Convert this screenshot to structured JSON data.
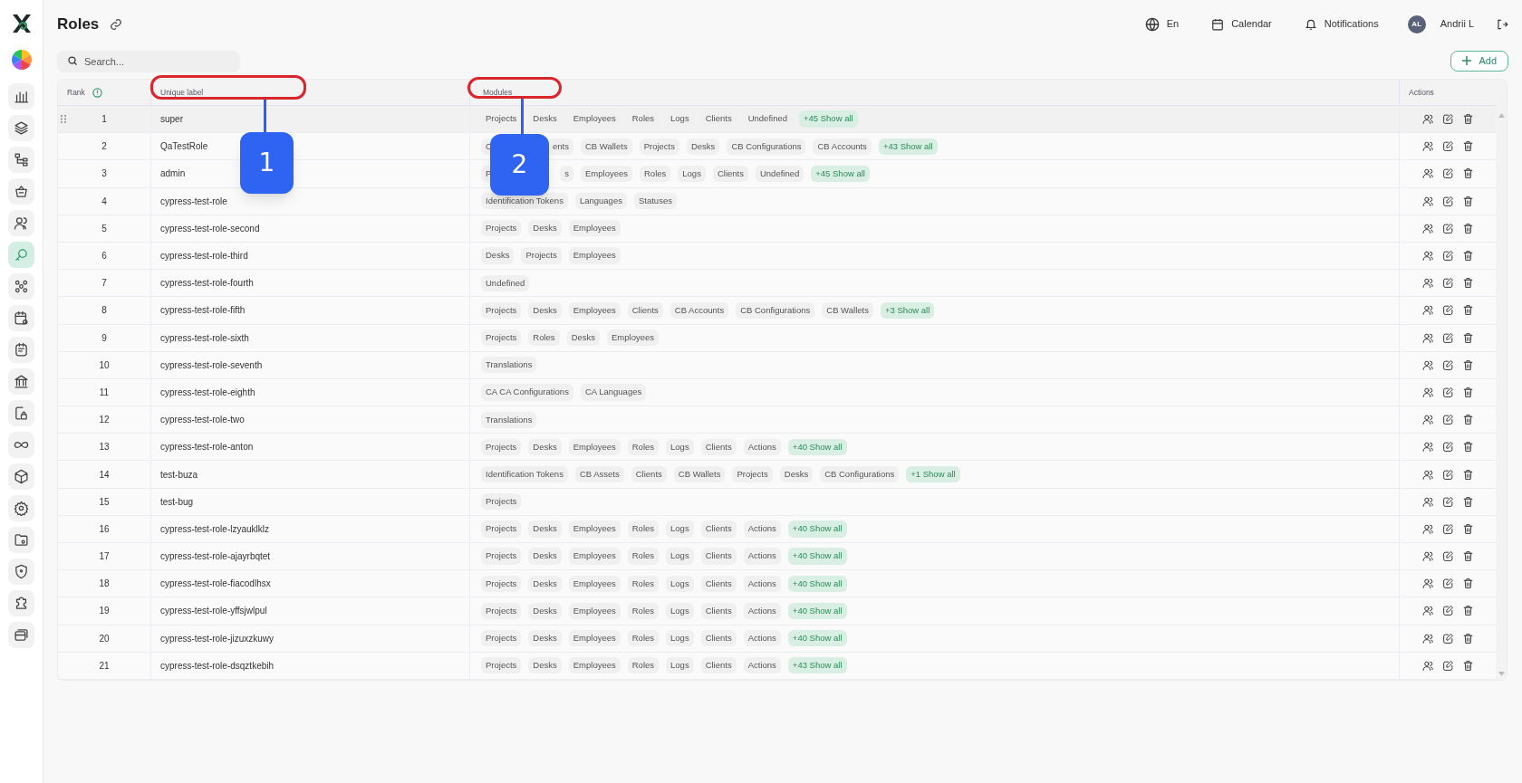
{
  "sidebar": {
    "items": [
      {
        "selected": false
      },
      {
        "selected": false
      },
      {
        "selected": false
      },
      {
        "selected": false
      },
      {
        "selected": false
      },
      {
        "selected": true
      },
      {
        "selected": false
      },
      {
        "selected": false
      },
      {
        "selected": false
      },
      {
        "selected": false
      },
      {
        "selected": false
      },
      {
        "selected": false
      },
      {
        "selected": false
      },
      {
        "selected": false
      },
      {
        "selected": false
      },
      {
        "selected": false
      },
      {
        "selected": false
      },
      {
        "selected": false
      }
    ]
  },
  "header": {
    "title": "Roles",
    "language": "En",
    "calendar": "Calendar",
    "notifications": "Notifications",
    "avatar": "AL",
    "user": "Andrii L"
  },
  "search": {
    "placeholder": "Search..."
  },
  "add_button": "Add",
  "table": {
    "columns": [
      "Rank",
      "Unique label",
      "Modules",
      "Actions"
    ],
    "rows": [
      {
        "rank": "1",
        "label": "super",
        "hovered": true,
        "modules": [
          {
            "kind": "module",
            "text": "Projects"
          },
          {
            "kind": "module",
            "text": "Desks"
          },
          {
            "kind": "module",
            "text": "Employees"
          },
          {
            "kind": "module",
            "text": "Roles"
          },
          {
            "kind": "module",
            "text": "Logs"
          },
          {
            "kind": "module",
            "text": "Clients"
          },
          {
            "kind": "module",
            "text": "Undefined"
          },
          {
            "kind": "more",
            "text": "+45 Show all"
          }
        ]
      },
      {
        "rank": "2",
        "label": "QaTestRole",
        "hovered": false,
        "modules": [
          {
            "kind": "split",
            "start": "C",
            "end": "ents"
          },
          {
            "kind": "module",
            "text": "CB Wallets"
          },
          {
            "kind": "module",
            "text": "Projects"
          },
          {
            "kind": "module",
            "text": "Desks"
          },
          {
            "kind": "module",
            "text": "CB Configurations"
          },
          {
            "kind": "module",
            "text": "CB Accounts"
          },
          {
            "kind": "more",
            "text": "+43 Show all"
          }
        ]
      },
      {
        "rank": "3",
        "label": "admin",
        "hovered": false,
        "modules": [
          {
            "kind": "split",
            "start": "P",
            "end": "s"
          },
          {
            "kind": "module",
            "text": "Employees"
          },
          {
            "kind": "module",
            "text": "Roles"
          },
          {
            "kind": "module",
            "text": "Logs"
          },
          {
            "kind": "module",
            "text": "Clients"
          },
          {
            "kind": "module",
            "text": "Undefined"
          },
          {
            "kind": "more",
            "text": "+45 Show all"
          }
        ]
      },
      {
        "rank": "4",
        "label": "cypress-test-role",
        "hovered": false,
        "modules": [
          {
            "kind": "module",
            "text": "Identification Tokens"
          },
          {
            "kind": "module",
            "text": "Languages"
          },
          {
            "kind": "module",
            "text": "Statuses"
          }
        ]
      },
      {
        "rank": "5",
        "label": "cypress-test-role-second",
        "hovered": false,
        "modules": [
          {
            "kind": "module",
            "text": "Projects"
          },
          {
            "kind": "module",
            "text": "Desks"
          },
          {
            "kind": "module",
            "text": "Employees"
          }
        ]
      },
      {
        "rank": "6",
        "label": "cypress-test-role-third",
        "hovered": false,
        "modules": [
          {
            "kind": "module",
            "text": "Desks"
          },
          {
            "kind": "module",
            "text": "Projects"
          },
          {
            "kind": "module",
            "text": "Employees"
          }
        ]
      },
      {
        "rank": "7",
        "label": "cypress-test-role-fourth",
        "hovered": false,
        "modules": [
          {
            "kind": "module",
            "text": "Undefined"
          }
        ]
      },
      {
        "rank": "8",
        "label": "cypress-test-role-fifth",
        "hovered": false,
        "modules": [
          {
            "kind": "module",
            "text": "Projects"
          },
          {
            "kind": "module",
            "text": "Desks"
          },
          {
            "kind": "module",
            "text": "Employees"
          },
          {
            "kind": "module",
            "text": "Clients"
          },
          {
            "kind": "module",
            "text": "CB Accounts"
          },
          {
            "kind": "module",
            "text": "CB Configurations"
          },
          {
            "kind": "module",
            "text": "CB Wallets"
          },
          {
            "kind": "more",
            "text": "+3 Show all"
          }
        ]
      },
      {
        "rank": "9",
        "label": "cypress-test-role-sixth",
        "hovered": false,
        "modules": [
          {
            "kind": "module",
            "text": "Projects"
          },
          {
            "kind": "module",
            "text": "Roles"
          },
          {
            "kind": "module",
            "text": "Desks"
          },
          {
            "kind": "module",
            "text": "Employees"
          }
        ]
      },
      {
        "rank": "10",
        "label": "cypress-test-role-seventh",
        "hovered": false,
        "modules": [
          {
            "kind": "module",
            "text": "Translations"
          }
        ]
      },
      {
        "rank": "11",
        "label": "cypress-test-role-eighth",
        "hovered": false,
        "modules": [
          {
            "kind": "module",
            "text": "CA CA Configurations"
          },
          {
            "kind": "module",
            "text": "CA Languages"
          }
        ]
      },
      {
        "rank": "12",
        "label": "cypress-test-role-two",
        "hovered": false,
        "modules": [
          {
            "kind": "module",
            "text": "Translations"
          }
        ]
      },
      {
        "rank": "13",
        "label": "cypress-test-role-anton",
        "hovered": false,
        "modules": [
          {
            "kind": "module",
            "text": "Projects"
          },
          {
            "kind": "module",
            "text": "Desks"
          },
          {
            "kind": "module",
            "text": "Employees"
          },
          {
            "kind": "module",
            "text": "Roles"
          },
          {
            "kind": "module",
            "text": "Logs"
          },
          {
            "kind": "module",
            "text": "Clients"
          },
          {
            "kind": "module",
            "text": "Actions"
          },
          {
            "kind": "more",
            "text": "+40 Show all"
          }
        ]
      },
      {
        "rank": "14",
        "label": "test-buza",
        "hovered": false,
        "modules": [
          {
            "kind": "module",
            "text": "Identification Tokens"
          },
          {
            "kind": "module",
            "text": "CB Assets"
          },
          {
            "kind": "module",
            "text": "Clients"
          },
          {
            "kind": "module",
            "text": "CB Wallets"
          },
          {
            "kind": "module",
            "text": "Projects"
          },
          {
            "kind": "module",
            "text": "Desks"
          },
          {
            "kind": "module",
            "text": "CB Configurations"
          },
          {
            "kind": "more",
            "text": "+1 Show all"
          }
        ]
      },
      {
        "rank": "15",
        "label": "test-bug",
        "hovered": false,
        "modules": [
          {
            "kind": "module",
            "text": "Projects"
          }
        ]
      },
      {
        "rank": "16",
        "label": "cypress-test-role-lzyauklklz",
        "hovered": false,
        "modules": [
          {
            "kind": "module",
            "text": "Projects"
          },
          {
            "kind": "module",
            "text": "Desks"
          },
          {
            "kind": "module",
            "text": "Employees"
          },
          {
            "kind": "module",
            "text": "Roles"
          },
          {
            "kind": "module",
            "text": "Logs"
          },
          {
            "kind": "module",
            "text": "Clients"
          },
          {
            "kind": "module",
            "text": "Actions"
          },
          {
            "kind": "more",
            "text": "+40 Show all"
          }
        ]
      },
      {
        "rank": "17",
        "label": "cypress-test-role-ajayrbqtet",
        "hovered": false,
        "modules": [
          {
            "kind": "module",
            "text": "Projects"
          },
          {
            "kind": "module",
            "text": "Desks"
          },
          {
            "kind": "module",
            "text": "Employees"
          },
          {
            "kind": "module",
            "text": "Roles"
          },
          {
            "kind": "module",
            "text": "Logs"
          },
          {
            "kind": "module",
            "text": "Clients"
          },
          {
            "kind": "module",
            "text": "Actions"
          },
          {
            "kind": "more",
            "text": "+40 Show all"
          }
        ]
      },
      {
        "rank": "18",
        "label": "cypress-test-role-fiacodlhsx",
        "hovered": false,
        "modules": [
          {
            "kind": "module",
            "text": "Projects"
          },
          {
            "kind": "module",
            "text": "Desks"
          },
          {
            "kind": "module",
            "text": "Employees"
          },
          {
            "kind": "module",
            "text": "Roles"
          },
          {
            "kind": "module",
            "text": "Logs"
          },
          {
            "kind": "module",
            "text": "Clients"
          },
          {
            "kind": "module",
            "text": "Actions"
          },
          {
            "kind": "more",
            "text": "+40 Show all"
          }
        ]
      },
      {
        "rank": "19",
        "label": "cypress-test-role-yffsjwlpul",
        "hovered": false,
        "modules": [
          {
            "kind": "module",
            "text": "Projects"
          },
          {
            "kind": "module",
            "text": "Desks"
          },
          {
            "kind": "module",
            "text": "Employees"
          },
          {
            "kind": "module",
            "text": "Roles"
          },
          {
            "kind": "module",
            "text": "Logs"
          },
          {
            "kind": "module",
            "text": "Clients"
          },
          {
            "kind": "module",
            "text": "Actions"
          },
          {
            "kind": "more",
            "text": "+40 Show all"
          }
        ]
      },
      {
        "rank": "20",
        "label": "cypress-test-role-jizuxzkuwy",
        "hovered": false,
        "modules": [
          {
            "kind": "module",
            "text": "Projects"
          },
          {
            "kind": "module",
            "text": "Desks"
          },
          {
            "kind": "module",
            "text": "Employees"
          },
          {
            "kind": "module",
            "text": "Roles"
          },
          {
            "kind": "module",
            "text": "Logs"
          },
          {
            "kind": "module",
            "text": "Clients"
          },
          {
            "kind": "module",
            "text": "Actions"
          },
          {
            "kind": "more",
            "text": "+40 Show all"
          }
        ]
      },
      {
        "rank": "21",
        "label": "cypress-test-role-dsqztkebih",
        "hovered": false,
        "modules": [
          {
            "kind": "module",
            "text": "Projects"
          },
          {
            "kind": "module",
            "text": "Desks"
          },
          {
            "kind": "module",
            "text": "Employees"
          },
          {
            "kind": "module",
            "text": "Roles"
          },
          {
            "kind": "module",
            "text": "Logs"
          },
          {
            "kind": "module",
            "text": "Clients"
          },
          {
            "kind": "module",
            "text": "Actions"
          },
          {
            "kind": "more",
            "text": "+43 Show all"
          }
        ]
      }
    ]
  },
  "callouts": [
    {
      "label": "1"
    },
    {
      "label": "2"
    }
  ]
}
